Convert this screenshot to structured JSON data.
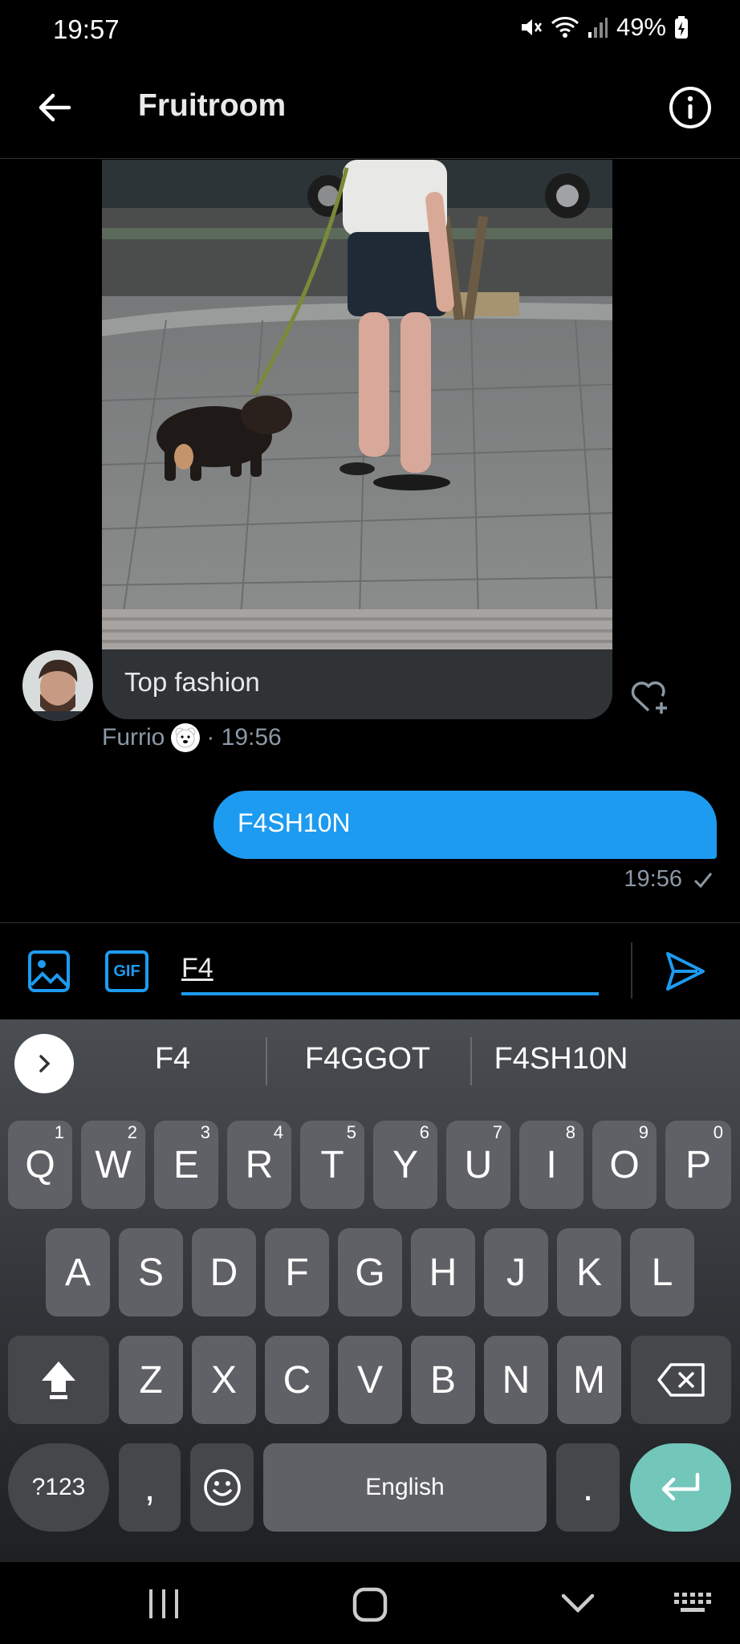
{
  "status": {
    "time": "19:57",
    "battery": "49%"
  },
  "header": {
    "title": "Fruitroom"
  },
  "incoming": {
    "caption": "Top fashion",
    "sender": "Furrio",
    "time": "· 19:56"
  },
  "outgoing": {
    "text": "F4SH10N",
    "time": "19:56"
  },
  "composer": {
    "gif_label": "GIF",
    "value": "F4"
  },
  "keyboard": {
    "suggestions": [
      "F4",
      "F4GGOT",
      "F4SH10N"
    ],
    "row1": [
      {
        "k": "Q",
        "n": "1"
      },
      {
        "k": "W",
        "n": "2"
      },
      {
        "k": "E",
        "n": "3"
      },
      {
        "k": "R",
        "n": "4"
      },
      {
        "k": "T",
        "n": "5"
      },
      {
        "k": "Y",
        "n": "6"
      },
      {
        "k": "U",
        "n": "7"
      },
      {
        "k": "I",
        "n": "8"
      },
      {
        "k": "O",
        "n": "9"
      },
      {
        "k": "P",
        "n": "0"
      }
    ],
    "row2": [
      "A",
      "S",
      "D",
      "F",
      "G",
      "H",
      "J",
      "K",
      "L"
    ],
    "row3": [
      "Z",
      "X",
      "C",
      "V",
      "B",
      "N",
      "M"
    ],
    "symbols_label": "?123",
    "comma": ",",
    "space_label": "English",
    "period": "."
  },
  "colors": {
    "accent": "#1d9bf0",
    "background": "#000000",
    "bubble_in": "#2f3336",
    "enter_key": "#72c6ba"
  }
}
